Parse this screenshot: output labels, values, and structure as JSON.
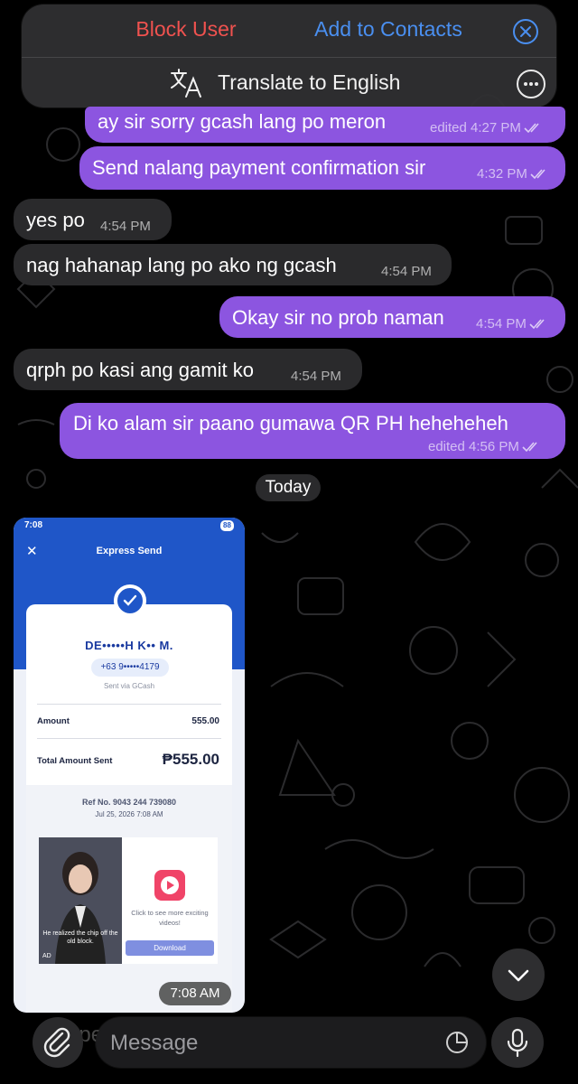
{
  "top_bar": {
    "block_label": "Block User",
    "add_contact_label": "Add to Contacts",
    "translate_label": "Translate to English"
  },
  "messages": [
    {
      "side": "out",
      "text": "ay sir sorry gcash lang po meron",
      "meta": "edited 4:27 PM"
    },
    {
      "side": "out",
      "text": "Send nalang payment confirmation sir",
      "meta": "4:32 PM"
    },
    {
      "side": "in",
      "text": "yes po",
      "meta": "4:54 PM"
    },
    {
      "side": "in",
      "text": "nag hahanap lang po ako ng gcash",
      "meta": "4:54 PM"
    },
    {
      "side": "out",
      "text": "Okay sir no prob naman",
      "meta": "4:54 PM"
    },
    {
      "side": "in",
      "text": "qrph po kasi ang gamit ko",
      "meta": "4:54 PM"
    },
    {
      "side": "out",
      "text": "Di ko alam sir paano gumawa QR PH heheheheh",
      "meta": "edited 4:56 PM"
    }
  ],
  "date_divider": "Today",
  "image_message": {
    "time": "7:08 AM",
    "screenshot": {
      "status_time": "7:08",
      "battery": "88",
      "title": "Express Send",
      "recipient_name": "DE•••••H K•• M.",
      "recipient_phone": "+63 9•••••4179",
      "sent_via": "Sent via GCash",
      "amount_label": "Amount",
      "amount_value": "555.00",
      "total_label": "Total Amount Sent",
      "total_value": "₱555.00",
      "ref_no": "Ref No. 9043 244 739080",
      "date": "Jul 25, 2026 7:08 AM",
      "ad_caption": "He realized the chip off the old block.",
      "ad_text": "Click to see more exciting videos!",
      "ad_button": "Download",
      "ad_tag": "AD"
    }
  },
  "composer": {
    "placeholder": "Message",
    "ghost_text": "he                  pe ito sa ang payment"
  },
  "colors": {
    "outgoing_bubble": "#8c55e0",
    "incoming_bubble": "#2a2a2c",
    "block_red": "#f0524f",
    "action_blue": "#4a8ff0",
    "gcash_blue": "#1f56c8"
  }
}
